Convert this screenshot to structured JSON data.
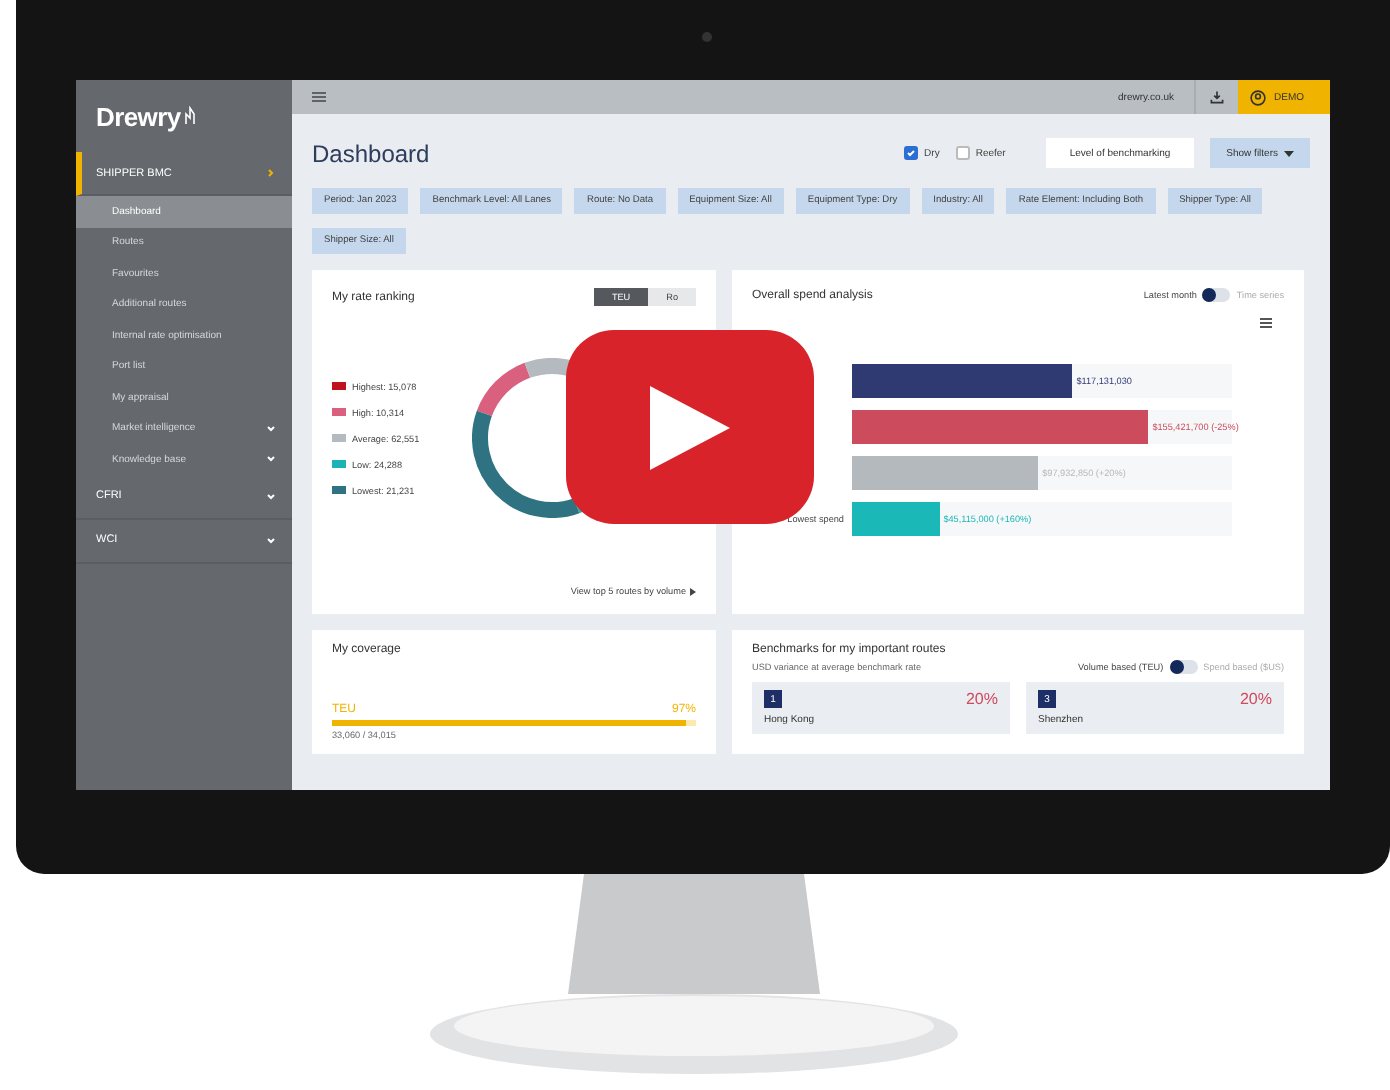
{
  "sidebar": {
    "logo": "Drewry",
    "sections": [
      {
        "label": "SHIPPER BMC",
        "expanded": true,
        "items": [
          {
            "label": "Dashboard",
            "selected": true,
            "submenu": false
          },
          {
            "label": "Routes",
            "selected": false,
            "submenu": false
          },
          {
            "label": "Favourites",
            "selected": false,
            "submenu": false
          },
          {
            "label": "Additional routes",
            "selected": false,
            "submenu": false
          },
          {
            "label": "Internal rate optimisation",
            "selected": false,
            "submenu": false
          },
          {
            "label": "Port list",
            "selected": false,
            "submenu": false
          },
          {
            "label": "My appraisal",
            "selected": false,
            "submenu": false
          },
          {
            "label": "Market intelligence",
            "selected": false,
            "submenu": true
          },
          {
            "label": "Knowledge base",
            "selected": false,
            "submenu": true
          }
        ]
      },
      {
        "label": "CFRI",
        "expanded": false
      },
      {
        "label": "WCI",
        "expanded": false
      }
    ]
  },
  "topbar": {
    "site": "drewry.co.uk",
    "user": "DEMO"
  },
  "header": {
    "title": "Dashboard",
    "checkboxes": [
      {
        "label": "Dry",
        "checked": true
      },
      {
        "label": "Reefer",
        "checked": false
      }
    ],
    "level_button": "Level of benchmarking",
    "filters_button": "Show filters"
  },
  "filters": [
    "Period: Jan 2023",
    "Benchmark Level: All Lanes",
    "Route: No Data",
    "Equipment Size: All",
    "Equipment Type: Dry",
    "Industry: All",
    "Rate Element: Including Both",
    "Shipper Type: All",
    "Shipper Size: All"
  ],
  "rate_ranking": {
    "title": "My rate ranking",
    "tabs": [
      {
        "label": "TEU",
        "selected": true
      },
      {
        "label": "Ro",
        "selected": false
      }
    ],
    "legend": [
      {
        "label": "Highest: 15,078",
        "color": "#c0121c"
      },
      {
        "label": "High: 10,314",
        "color": "#d9607e"
      },
      {
        "label": "Average: 62,551",
        "color": "#b4babf"
      },
      {
        "label": "Low: 24,288",
        "color": "#1bb3b5"
      },
      {
        "label": "Lowest: 21,231",
        "color": "#2f7383"
      }
    ],
    "link": "View top 5 routes by volume"
  },
  "spend": {
    "title": "Overall spend analysis",
    "toggle": {
      "left": "Latest month",
      "right": "Time series",
      "on": false
    },
    "bars": [
      {
        "value_label": "$117,131,030",
        "color": "#2f3a73",
        "level": 0.58
      },
      {
        "value_label": "$155,421,700 (-25%)",
        "color": "#cc4b5d",
        "level": 0.78
      },
      {
        "value_label": "$97,932,850 (+20%)",
        "color": "#b4b9be",
        "level": 0.49
      },
      {
        "category": "Lowest spend",
        "value_label": "$45,115,000 (+160%)",
        "color": "#1bb8b8",
        "level": 0.23
      }
    ]
  },
  "coverage": {
    "title": "My coverage",
    "label": "TEU",
    "percent": "97%",
    "level": 0.97,
    "detail": "33,060 / 34,015"
  },
  "benchmarks": {
    "title": "Benchmarks for my important routes",
    "subtitle": "USD variance at average benchmark rate",
    "toggle": {
      "left": "Volume based (TEU)",
      "right": "Spend based ($US)",
      "on": false
    },
    "routes": [
      {
        "rank": "1",
        "change": "20%",
        "city": "Hong Kong"
      },
      {
        "rank": "3",
        "change": "20%",
        "city": "Shenzhen"
      }
    ]
  }
}
